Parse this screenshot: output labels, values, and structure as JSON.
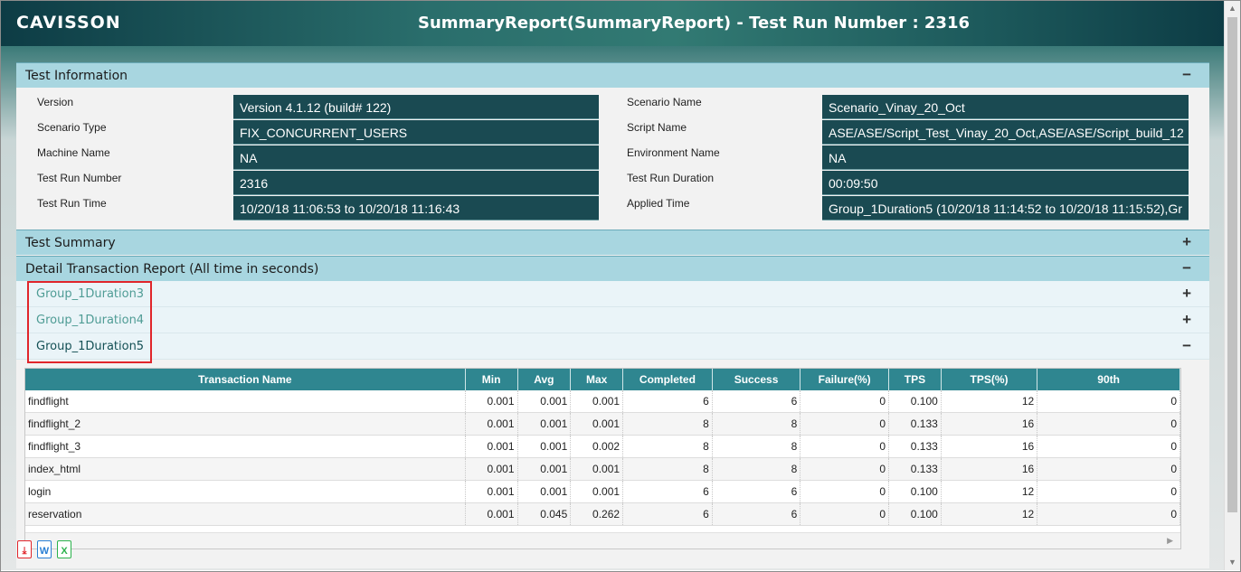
{
  "header": {
    "logo": "CAVISSON",
    "title": "SummaryReport(SummaryReport) - Test Run Number : 2316"
  },
  "test_information": {
    "title": "Test Information",
    "toggle": "−",
    "left": [
      {
        "label": "Version",
        "value": "Version 4.1.12 (build# 122)"
      },
      {
        "label": "Scenario Type",
        "value": "FIX_CONCURRENT_USERS"
      },
      {
        "label": "Machine Name",
        "value": "NA"
      },
      {
        "label": "Test Run Number",
        "value": "2316"
      },
      {
        "label": "Test Run Time",
        "value": "10/20/18  11:06:53 to 10/20/18 11:16:43"
      }
    ],
    "right": [
      {
        "label": "Scenario Name",
        "value": "Scenario_Vinay_20_Oct"
      },
      {
        "label": "Script Name",
        "value": "ASE/ASE/Script_Test_Vinay_20_Oct,ASE/ASE/Script_build_12"
      },
      {
        "label": "Environment Name",
        "value": "NA"
      },
      {
        "label": "Test Run Duration",
        "value": "00:09:50"
      },
      {
        "label": "Applied Time",
        "value": "Group_1Duration5 (10/20/18 11:14:52 to 10/20/18 11:15:52),Gr"
      }
    ]
  },
  "test_summary": {
    "title": "Test Summary",
    "toggle": "+"
  },
  "detail_report": {
    "title": "Detail Transaction Report (All time in seconds)",
    "toggle": "−",
    "groups": [
      {
        "label": "Group_1Duration3",
        "toggle": "+"
      },
      {
        "label": "Group_1Duration4",
        "toggle": "+"
      },
      {
        "label": "Group_1Duration5",
        "toggle": "−"
      }
    ],
    "columns": [
      "Transaction Name",
      "Min",
      "Avg",
      "Max",
      "Completed",
      "Success",
      "Failure(%)",
      "TPS",
      "TPS(%)",
      "90th"
    ],
    "rows": [
      [
        "findflight",
        "0.001",
        "0.001",
        "0.001",
        "6",
        "6",
        "0",
        "0.100",
        "12",
        "0"
      ],
      [
        "findflight_2",
        "0.001",
        "0.001",
        "0.001",
        "8",
        "8",
        "0",
        "0.133",
        "16",
        "0"
      ],
      [
        "findflight_3",
        "0.001",
        "0.001",
        "0.002",
        "8",
        "8",
        "0",
        "0.133",
        "16",
        "0"
      ],
      [
        "index_html",
        "0.001",
        "0.001",
        "0.001",
        "8",
        "8",
        "0",
        "0.133",
        "16",
        "0"
      ],
      [
        "login",
        "0.001",
        "0.001",
        "0.001",
        "6",
        "6",
        "0",
        "0.100",
        "12",
        "0"
      ],
      [
        "reservation",
        "0.001",
        "0.045",
        "0.262",
        "6",
        "6",
        "0",
        "0.100",
        "12",
        "0"
      ]
    ]
  },
  "exports": [
    {
      "icon": "pdf-export-icon",
      "glyph": "⤓",
      "color": "#e0252b"
    },
    {
      "icon": "word-export-icon",
      "glyph": "W",
      "color": "#2a7fd4"
    },
    {
      "icon": "excel-export-icon",
      "glyph": "X",
      "color": "#2bb24c"
    }
  ],
  "colors": {
    "header": "#1d5a5c",
    "section_header": "#a8d6e0",
    "info_value_bg": "#1a4a52",
    "table_header": "#2f8690",
    "highlight": "#e0252b"
  }
}
